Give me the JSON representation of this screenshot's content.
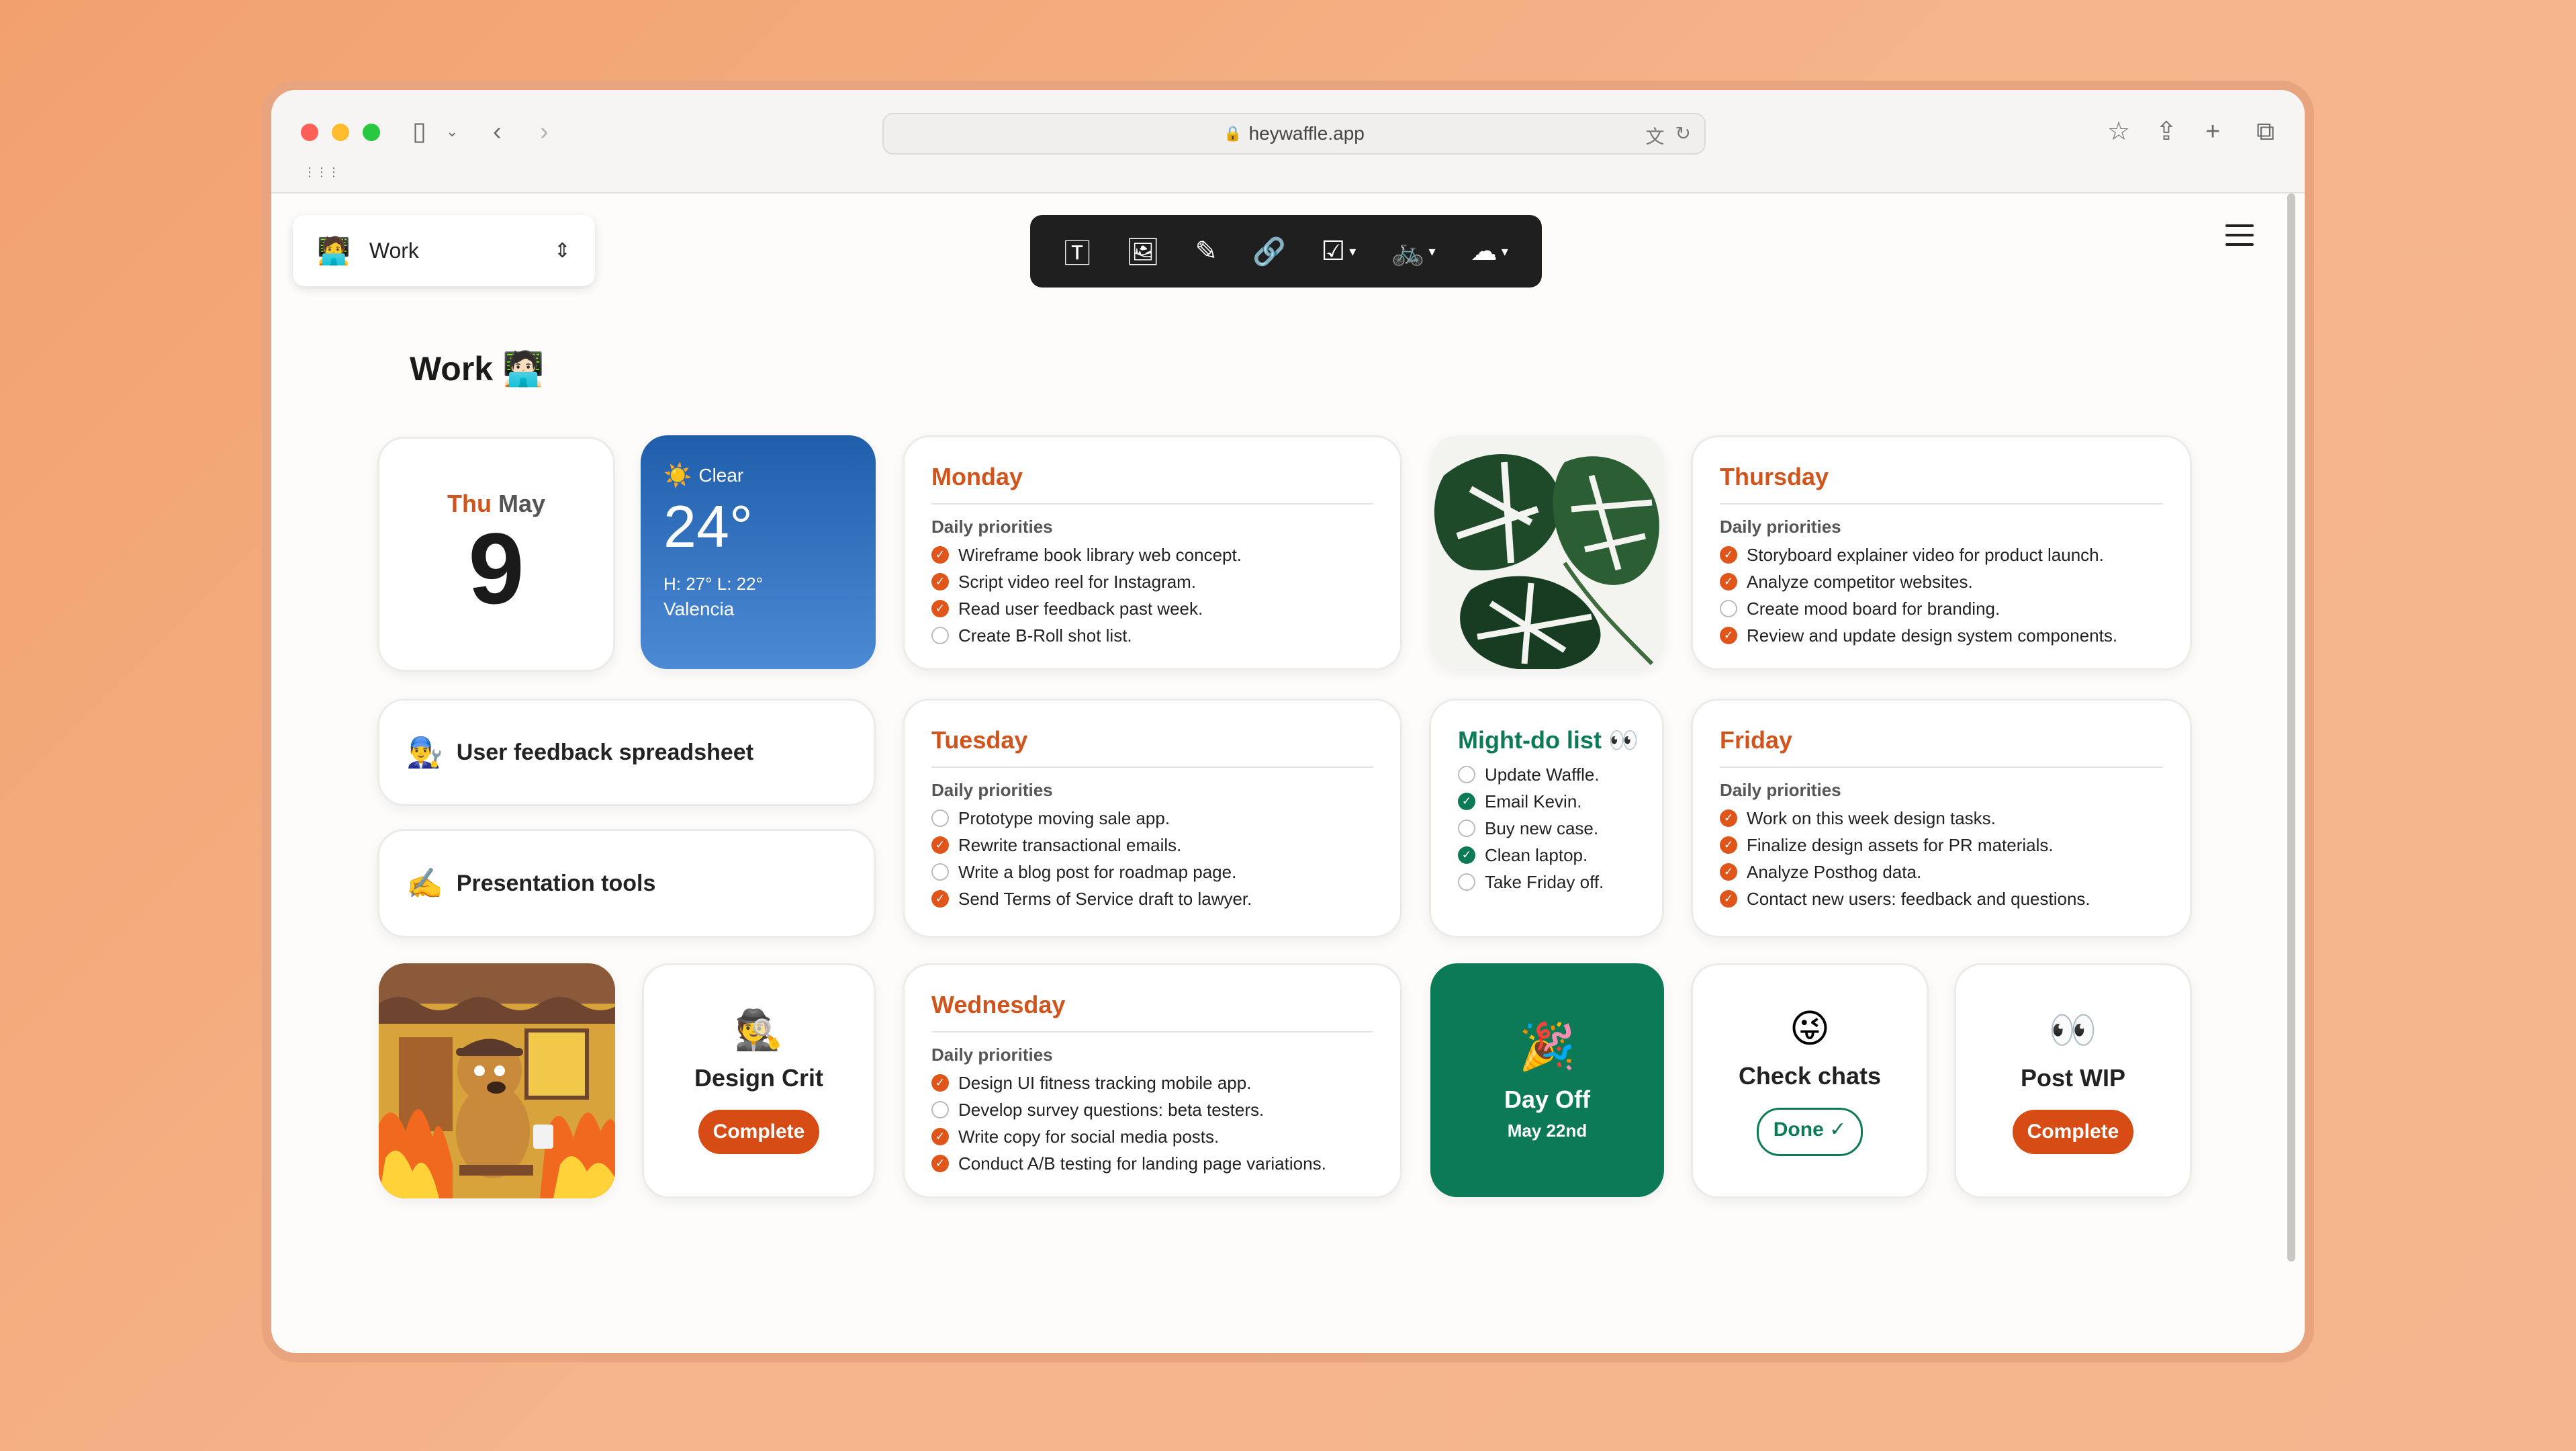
{
  "browser": {
    "url": "heywaffle.app",
    "traffic_lights": {
      "close": "#fe5f57",
      "minimize": "#febc2e",
      "zoom": "#28c840"
    }
  },
  "space_selector": {
    "emoji": "🧑‍💻",
    "label": "Work",
    "chevron": "⌃⌄"
  },
  "toolbar": {
    "items": [
      "text-icon",
      "image-icon",
      "note-icon",
      "link-icon",
      "checklist-icon",
      "bike-icon",
      "weather-icon"
    ]
  },
  "page": {
    "title": "Work 🧑🏻‍💻"
  },
  "date_card": {
    "weekday": "Thu",
    "month": "May",
    "day": "9"
  },
  "weather": {
    "condition": "Clear",
    "icon": "☀️",
    "temp": "24°",
    "hilo": "H: 27° L: 22°",
    "city": "Valencia"
  },
  "monday": {
    "title": "Monday",
    "subtitle": "Daily priorities",
    "tasks": [
      {
        "text": "Wireframe book library web concept.",
        "done": true
      },
      {
        "text": "Script video reel for Instagram.",
        "done": true
      },
      {
        "text": "Read user feedback past week.",
        "done": true
      },
      {
        "text": "Create B-Roll shot list.",
        "done": false
      }
    ]
  },
  "thursday": {
    "title": "Thursday",
    "subtitle": "Daily priorities",
    "tasks": [
      {
        "text": "Storyboard explainer video for product launch.",
        "done": true
      },
      {
        "text": "Analyze competitor websites.",
        "done": true
      },
      {
        "text": "Create mood board for branding.",
        "done": false
      },
      {
        "text": "Review and update design system components.",
        "done": true
      }
    ]
  },
  "tuesday": {
    "title": "Tuesday",
    "subtitle": "Daily priorities",
    "tasks": [
      {
        "text": "Prototype moving sale app.",
        "done": false
      },
      {
        "text": "Rewrite transactional emails.",
        "done": true
      },
      {
        "text": "Write a blog post for roadmap page.",
        "done": false
      },
      {
        "text": "Send Terms of Service draft to lawyer.",
        "done": true
      }
    ]
  },
  "might_do": {
    "title": "Might-do list 👀",
    "tasks": [
      {
        "text": "Update Waffle.",
        "done": false
      },
      {
        "text": "Email Kevin.",
        "done": true
      },
      {
        "text": "Buy new case.",
        "done": false
      },
      {
        "text": "Clean laptop.",
        "done": true
      },
      {
        "text": "Take Friday off.",
        "done": false
      }
    ]
  },
  "friday": {
    "title": "Friday",
    "subtitle": "Daily priorities",
    "tasks": [
      {
        "text": "Work on this week design tasks.",
        "done": true
      },
      {
        "text": "Finalize design assets for PR materials.",
        "done": true
      },
      {
        "text": "Analyze Posthog data.",
        "done": true
      },
      {
        "text": "Contact new users: feedback and questions.",
        "done": true
      }
    ]
  },
  "wednesday": {
    "title": "Wednesday",
    "subtitle": "Daily priorities",
    "tasks": [
      {
        "text": "Design UI fitness tracking mobile app.",
        "done": true
      },
      {
        "text": "Develop survey questions: beta testers.",
        "done": false
      },
      {
        "text": "Write copy for social media posts.",
        "done": true
      },
      {
        "text": "Conduct A/B testing for landing page variations.",
        "done": true
      }
    ]
  },
  "links": [
    {
      "emoji": "👨‍🔧",
      "label": "User feedback spreadsheet"
    },
    {
      "emoji": "✍️",
      "label": "Presentation tools"
    }
  ],
  "design_crit": {
    "emoji": "🕵️",
    "label": "Design Crit",
    "button": "Complete"
  },
  "day_off": {
    "emoji": "🎉",
    "label": "Day Off",
    "date": "May 22nd",
    "color": "#0c7a57"
  },
  "check_chats": {
    "emoji": "😜",
    "label": "Check chats",
    "button": "Done ✓"
  },
  "post_wip": {
    "emoji": "👀",
    "label": "Post WIP",
    "button": "Complete"
  },
  "accent_orange": "#d74c15"
}
